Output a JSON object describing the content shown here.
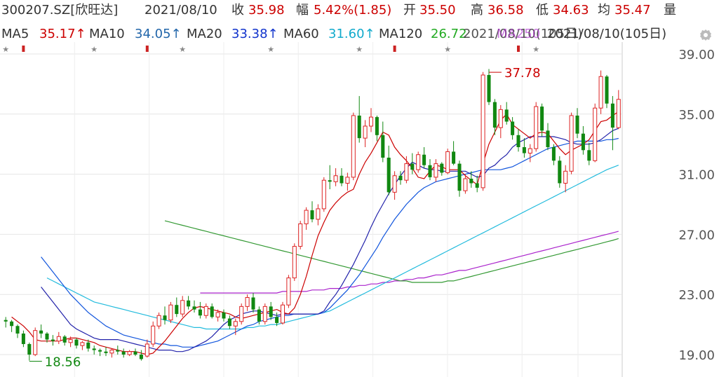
{
  "header": {
    "code": "300207.SZ[欣旺达]",
    "date": "2021/08/10",
    "close_label": "收",
    "close_value": "35.98",
    "change_label": "幅",
    "change_value": "5.42%(1.85)",
    "open_label": "开",
    "open_value": "35.50",
    "high_label": "高",
    "high_value": "36.58",
    "low_label": "低",
    "low_value": "34.63",
    "avg_label": "均",
    "avg_value": "35.47",
    "volume_label": "量"
  },
  "ma_bar": {
    "ma5_label": "MA5",
    "ma5_value": "35.17↑",
    "ma10_label": "MA10",
    "ma10_value": "34.05↑",
    "ma20_label": "MA20",
    "ma20_value": "33.38↑",
    "ma60_label": "MA60",
    "ma60_value": "31.60↑",
    "ma120_label": "MA120",
    "ma120_value": "26.72",
    "ma250_overlap": "MA250",
    "period": "2021/08/10(105日)",
    "settings_icon": "gear-icon"
  },
  "colors": {
    "up": "#dd2222",
    "down": "#118811",
    "ma5": "#cc0000",
    "ma10": "#2222aa",
    "ma20": "#1155dd",
    "ma60": "#22bbdd",
    "ma120": "#339933",
    "ma250": "#aa22cc"
  },
  "chart_data": {
    "type": "candlestick",
    "y_ticks": [
      "39.00",
      "35.00",
      "31.00",
      "27.00",
      "23.00",
      "19.00"
    ],
    "ylim": [
      19.0,
      39.0
    ],
    "max_label": "37.78",
    "min_label": "18.56",
    "candles": [
      [
        21.3,
        21.5,
        20.8,
        21.2
      ],
      [
        21.2,
        21.3,
        20.5,
        20.9
      ],
      [
        20.9,
        21.0,
        20.1,
        20.4
      ],
      [
        20.4,
        20.6,
        19.5,
        19.7
      ],
      [
        19.7,
        19.8,
        18.6,
        19.0
      ],
      [
        19.0,
        20.8,
        18.9,
        20.6
      ],
      [
        20.6,
        21.0,
        20.1,
        20.4
      ],
      [
        20.4,
        20.5,
        19.8,
        20.0
      ],
      [
        20.0,
        20.3,
        19.6,
        19.9
      ],
      [
        19.9,
        20.5,
        19.7,
        20.2
      ],
      [
        20.2,
        20.3,
        19.6,
        19.8
      ],
      [
        19.8,
        20.2,
        19.5,
        20.0
      ],
      [
        20.0,
        20.1,
        19.4,
        19.6
      ],
      [
        19.6,
        19.9,
        19.3,
        19.8
      ],
      [
        19.8,
        20.0,
        19.2,
        19.4
      ],
      [
        19.4,
        19.6,
        19.0,
        19.3
      ],
      [
        19.3,
        19.4,
        18.9,
        19.2
      ],
      [
        19.2,
        19.5,
        18.9,
        19.1
      ],
      [
        19.1,
        19.4,
        18.8,
        19.3
      ],
      [
        19.3,
        19.6,
        19.0,
        19.2
      ],
      [
        19.2,
        19.4,
        18.8,
        19.0
      ],
      [
        19.0,
        19.3,
        18.9,
        19.2
      ],
      [
        19.2,
        19.4,
        18.9,
        19.0
      ],
      [
        19.0,
        19.3,
        18.6,
        18.7
      ],
      [
        18.9,
        20.0,
        18.8,
        19.7
      ],
      [
        19.7,
        21.2,
        19.5,
        20.9
      ],
      [
        20.9,
        21.8,
        20.7,
        21.6
      ],
      [
        21.6,
        22.2,
        21.0,
        21.3
      ],
      [
        21.3,
        22.5,
        21.1,
        22.3
      ],
      [
        22.3,
        22.8,
        21.5,
        21.7
      ],
      [
        21.7,
        22.9,
        21.5,
        22.6
      ],
      [
        22.6,
        22.9,
        22.0,
        22.2
      ],
      [
        22.2,
        22.6,
        21.8,
        22.0
      ],
      [
        22.0,
        22.5,
        21.4,
        21.6
      ],
      [
        21.6,
        22.4,
        21.4,
        22.2
      ],
      [
        22.2,
        22.4,
        21.4,
        21.5
      ],
      [
        21.5,
        22.0,
        21.2,
        21.8
      ],
      [
        21.8,
        22.0,
        21.2,
        21.4
      ],
      [
        21.4,
        21.6,
        20.7,
        20.9
      ],
      [
        20.9,
        21.4,
        20.3,
        21.2
      ],
      [
        21.2,
        22.4,
        21.0,
        22.2
      ],
      [
        22.2,
        23.0,
        21.9,
        22.8
      ],
      [
        22.8,
        23.1,
        21.8,
        22.0
      ],
      [
        22.0,
        22.2,
        21.0,
        21.2
      ],
      [
        21.2,
        22.4,
        21.0,
        22.2
      ],
      [
        22.2,
        22.5,
        21.3,
        21.5
      ],
      [
        21.5,
        21.8,
        20.9,
        21.1
      ],
      [
        21.1,
        22.5,
        21.0,
        22.3
      ],
      [
        22.3,
        24.3,
        22.1,
        24.1
      ],
      [
        24.1,
        26.4,
        23.9,
        26.2
      ],
      [
        26.2,
        27.9,
        26.0,
        27.7
      ],
      [
        27.7,
        28.8,
        27.3,
        28.6
      ],
      [
        28.6,
        29.2,
        27.8,
        28.0
      ],
      [
        28.0,
        29.0,
        27.6,
        28.7
      ],
      [
        28.7,
        30.8,
        28.5,
        30.6
      ],
      [
        30.6,
        31.6,
        30.0,
        30.5
      ],
      [
        30.5,
        31.4,
        30.2,
        30.9
      ],
      [
        30.9,
        31.4,
        30.2,
        30.4
      ],
      [
        30.4,
        31.1,
        29.9,
        30.8
      ],
      [
        30.8,
        35.1,
        30.6,
        34.9
      ],
      [
        34.9,
        36.2,
        33.1,
        33.4
      ],
      [
        33.4,
        34.6,
        32.8,
        34.2
      ],
      [
        34.2,
        35.4,
        33.8,
        34.8
      ],
      [
        34.8,
        34.9,
        33.2,
        33.6
      ],
      [
        33.6,
        34.5,
        31.8,
        32.1
      ],
      [
        32.1,
        32.9,
        29.6,
        29.8
      ],
      [
        29.8,
        31.2,
        29.3,
        30.9
      ],
      [
        30.9,
        31.2,
        30.3,
        30.6
      ],
      [
        30.6,
        32.2,
        30.4,
        31.7
      ],
      [
        31.7,
        32.4,
        31.0,
        31.3
      ],
      [
        31.3,
        32.5,
        31.1,
        32.3
      ],
      [
        32.3,
        32.8,
        31.4,
        31.6
      ],
      [
        31.6,
        32.0,
        30.6,
        30.8
      ],
      [
        30.8,
        32.0,
        30.5,
        31.7
      ],
      [
        31.7,
        31.8,
        30.9,
        31.1
      ],
      [
        31.1,
        32.7,
        31.0,
        32.5
      ],
      [
        32.5,
        33.2,
        31.6,
        31.7
      ],
      [
        31.7,
        31.9,
        29.5,
        29.9
      ],
      [
        29.9,
        31.0,
        29.7,
        30.7
      ],
      [
        30.7,
        31.2,
        30.1,
        30.4
      ],
      [
        30.4,
        30.9,
        29.8,
        30.1
      ],
      [
        30.1,
        37.8,
        29.9,
        37.6
      ],
      [
        37.6,
        38.0,
        35.6,
        35.8
      ],
      [
        35.8,
        36.0,
        33.6,
        34.1
      ],
      [
        34.1,
        35.6,
        33.4,
        35.3
      ],
      [
        35.3,
        35.8,
        34.3,
        34.5
      ],
      [
        34.5,
        34.8,
        33.3,
        33.6
      ],
      [
        33.6,
        34.0,
        32.5,
        32.8
      ],
      [
        32.8,
        33.4,
        32.1,
        32.4
      ],
      [
        32.4,
        33.0,
        31.8,
        32.7
      ],
      [
        32.7,
        35.8,
        32.5,
        35.5
      ],
      [
        35.5,
        35.7,
        33.5,
        33.9
      ],
      [
        33.9,
        34.4,
        32.6,
        32.8
      ],
      [
        32.8,
        33.0,
        31.6,
        31.9
      ],
      [
        31.9,
        32.2,
        30.1,
        30.4
      ],
      [
        30.4,
        31.6,
        29.8,
        31.2
      ],
      [
        31.2,
        35.1,
        31.0,
        34.9
      ],
      [
        34.9,
        35.4,
        33.4,
        33.7
      ],
      [
        33.7,
        34.2,
        32.3,
        32.6
      ],
      [
        32.6,
        33.1,
        31.6,
        31.9
      ],
      [
        31.9,
        35.7,
        31.8,
        35.4
      ],
      [
        35.4,
        37.9,
        35.0,
        37.5
      ],
      [
        37.5,
        37.6,
        35.4,
        35.7
      ],
      [
        35.7,
        36.2,
        32.6,
        34.1
      ],
      [
        34.1,
        36.6,
        34.0,
        35.98
      ]
    ],
    "ma5": [
      21.5,
      21.2,
      20.9,
      20.5,
      20.0,
      19.9,
      19.9,
      19.9,
      19.9,
      20.0,
      20.1,
      20.1,
      20.0,
      19.9,
      19.8,
      19.6,
      19.5,
      19.4,
      19.3,
      19.2,
      19.2,
      19.2,
      19.1,
      19.0,
      19.1,
      19.5,
      19.9,
      20.4,
      20.9,
      21.4,
      21.8,
      22.1,
      22.2,
      22.1,
      22.0,
      21.9,
      21.8,
      21.7,
      21.5,
      21.4,
      21.5,
      21.6,
      21.7,
      21.8,
      21.9,
      22.0,
      21.8,
      21.7,
      22.1,
      23.0,
      24.2,
      25.6,
      26.9,
      27.8,
      28.6,
      29.1,
      29.5,
      29.8,
      30.0,
      31.0,
      31.8,
      32.4,
      33.1,
      33.8,
      33.6,
      32.8,
      32.3,
      31.9,
      31.4,
      30.8,
      30.7,
      31.2,
      31.6,
      31.5,
      31.3,
      31.3,
      31.3,
      30.9,
      30.6,
      30.3,
      31.7,
      33.0,
      33.8,
      34.6,
      35.0,
      34.3,
      34.0,
      33.7,
      33.4,
      33.7,
      33.8,
      33.7,
      33.2,
      32.7,
      32.3,
      32.6,
      32.8,
      33.0,
      33.3,
      33.9,
      34.5,
      34.6,
      34.9,
      35.17
    ],
    "ma10": [
      23.5,
      23.0,
      22.5,
      22.0,
      21.5,
      21.0,
      20.7,
      20.5,
      20.3,
      20.1,
      20.0,
      20.0,
      20.0,
      20.0,
      19.9,
      19.8,
      19.7,
      19.6,
      19.5,
      19.4,
      19.3,
      19.3,
      19.3,
      19.2,
      19.2,
      19.3,
      19.5,
      19.7,
      19.9,
      20.2,
      20.6,
      21.0,
      21.3,
      21.5,
      21.7,
      21.8,
      21.9,
      21.9,
      21.8,
      21.7,
      21.6,
      21.7,
      21.7,
      21.7,
      21.7,
      21.7,
      21.7,
      21.7,
      21.9,
      22.5,
      23.0,
      23.6,
      24.3,
      25.0,
      25.8,
      26.6,
      27.5,
      28.3,
      29.0,
      29.7,
      30.3,
      30.9,
      31.4,
      31.8,
      31.6,
      31.4,
      31.3,
      31.3,
      31.2,
      31.2,
      31.2,
      31.2,
      31.2,
      31.0,
      30.8,
      30.9,
      31.4,
      31.6,
      32.0,
      32.3,
      32.8,
      33.1,
      33.3,
      33.5,
      33.5,
      33.5,
      33.5,
      33.5,
      33.4,
      33.3,
      33.1,
      33.0,
      33.0,
      33.0,
      33.1,
      33.3,
      33.6,
      33.9,
      34.05
    ],
    "ma20": [
      25.5,
      25.0,
      24.5,
      24.0,
      23.5,
      23.0,
      22.6,
      22.2,
      21.8,
      21.5,
      21.2,
      20.9,
      20.7,
      20.5,
      20.3,
      20.2,
      20.1,
      20.0,
      19.9,
      19.8,
      19.7,
      19.7,
      19.6,
      19.6,
      19.5,
      19.5,
      19.5,
      19.6,
      19.7,
      19.8,
      19.9,
      20.1,
      20.3,
      20.5,
      20.7,
      20.9,
      21.0,
      21.2,
      21.3,
      21.4,
      21.5,
      21.6,
      21.6,
      21.7,
      21.7,
      21.7,
      21.7,
      21.7,
      21.8,
      22.1,
      22.5,
      22.9,
      23.3,
      23.8,
      24.3,
      24.9,
      25.5,
      26.1,
      26.8,
      27.4,
      28.0,
      28.5,
      29.0,
      29.4,
      29.8,
      30.1,
      30.3,
      30.5,
      30.6,
      30.7,
      30.8,
      30.9,
      31.0,
      31.1,
      31.2,
      31.3,
      31.3,
      31.3,
      31.3,
      31.4,
      31.5,
      31.7,
      31.9,
      32.1,
      32.3,
      32.5,
      32.7,
      32.8,
      32.9,
      33.0,
      33.1,
      33.2,
      33.2,
      33.2,
      33.2,
      33.2,
      33.3,
      33.3,
      33.38
    ],
    "ma60": [
      24.1,
      23.9,
      23.7,
      23.5,
      23.3,
      23.1,
      22.9,
      22.7,
      22.5,
      22.4,
      22.3,
      22.2,
      22.1,
      22.0,
      21.9,
      21.8,
      21.7,
      21.6,
      21.5,
      21.4,
      21.3,
      21.2,
      21.1,
      21.0,
      20.9,
      20.8,
      20.8,
      20.7,
      20.7,
      20.7,
      20.7,
      20.7,
      20.7,
      20.7,
      20.8,
      20.8,
      20.9,
      20.9,
      21.0,
      21.0,
      21.1,
      21.2,
      21.3,
      21.4,
      21.5,
      21.6,
      21.7,
      21.8,
      21.9,
      22.1,
      22.3,
      22.5,
      22.7,
      22.9,
      23.1,
      23.3,
      23.5,
      23.7,
      23.9,
      24.1,
      24.3,
      24.5,
      24.7,
      24.9,
      25.1,
      25.3,
      25.5,
      25.7,
      25.9,
      26.1,
      26.3,
      26.5,
      26.7,
      26.9,
      27.1,
      27.3,
      27.5,
      27.7,
      27.9,
      28.1,
      28.3,
      28.5,
      28.7,
      28.9,
      29.1,
      29.3,
      29.5,
      29.7,
      29.9,
      30.1,
      30.3,
      30.5,
      30.7,
      30.9,
      31.1,
      31.3,
      31.45,
      31.6
    ],
    "ma120": [
      27.9,
      27.8,
      27.7,
      27.6,
      27.5,
      27.4,
      27.3,
      27.2,
      27.1,
      27.0,
      26.9,
      26.8,
      26.7,
      26.6,
      26.5,
      26.4,
      26.3,
      26.2,
      26.1,
      26.0,
      25.9,
      25.8,
      25.7,
      25.6,
      25.5,
      25.4,
      25.3,
      25.2,
      25.1,
      25.0,
      24.9,
      24.8,
      24.7,
      24.6,
      24.5,
      24.4,
      24.3,
      24.2,
      24.1,
      24.0,
      23.9,
      23.9,
      23.8,
      23.8,
      23.8,
      23.8,
      23.8,
      23.8,
      23.9,
      23.9,
      24.0,
      24.1,
      24.2,
      24.3,
      24.4,
      24.5,
      24.6,
      24.7,
      24.8,
      24.9,
      25.0,
      25.1,
      25.2,
      25.3,
      25.4,
      25.5,
      25.6,
      25.7,
      25.8,
      25.9,
      26.0,
      26.1,
      26.2,
      26.3,
      26.4,
      26.5,
      26.6,
      26.72
    ],
    "ma250": [
      23.1,
      23.1,
      23.1,
      23.1,
      23.1,
      23.1,
      23.1,
      23.1,
      23.1,
      23.1,
      23.1,
      23.1,
      23.1,
      23.1,
      23.2,
      23.2,
      23.2,
      23.2,
      23.2,
      23.3,
      23.3,
      23.3,
      23.4,
      23.4,
      23.4,
      23.5,
      23.5,
      23.6,
      23.6,
      23.7,
      23.7,
      23.8,
      23.8,
      23.9,
      23.9,
      24.0,
      24.0,
      24.1,
      24.1,
      24.2,
      24.3,
      24.3,
      24.4,
      24.5,
      24.6,
      24.6,
      24.7,
      24.8,
      24.9,
      25.0,
      25.1,
      25.2,
      25.3,
      25.4,
      25.5,
      25.6,
      25.7,
      25.8,
      25.9,
      26.0,
      26.1,
      26.2,
      26.3,
      26.4,
      26.5,
      26.6,
      26.7,
      26.8,
      26.9,
      27.0,
      27.1,
      27.2
    ]
  }
}
